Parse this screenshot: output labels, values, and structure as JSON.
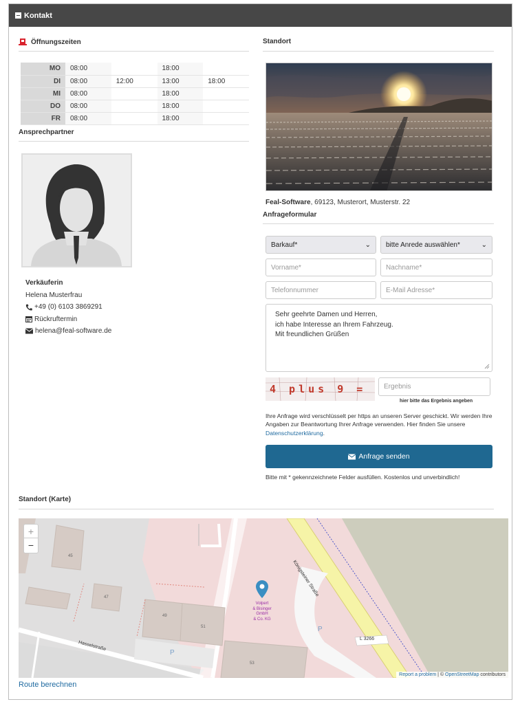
{
  "header": {
    "title": "Kontakt"
  },
  "hours": {
    "title": "Öffnungszeiten",
    "rows": [
      {
        "day": "MO",
        "c1": "08:00",
        "c2": "",
        "c3": "18:00",
        "c4": ""
      },
      {
        "day": "DI",
        "c1": "08:00",
        "c2": "12:00",
        "c3": "13:00",
        "c4": "18:00"
      },
      {
        "day": "MI",
        "c1": "08:00",
        "c2": "",
        "c3": "18:00",
        "c4": ""
      },
      {
        "day": "DO",
        "c1": "08:00",
        "c2": "",
        "c3": "18:00",
        "c4": ""
      },
      {
        "day": "FR",
        "c1": "08:00",
        "c2": "",
        "c3": "18:00",
        "c4": ""
      }
    ]
  },
  "contact_person": {
    "title": "Ansprechpartner",
    "role": "Verkäuferin",
    "name": "Helena Musterfrau",
    "phone": "+49 (0) 6103 3869291",
    "callback": "Rückruftermin",
    "email": "helena@feal-software.de"
  },
  "location": {
    "title": "Standort",
    "company": "Feal-Software",
    "address": ", 69123, Musterort, Musterstr. 22"
  },
  "form": {
    "title": "Anfrageformular",
    "type_select": "Barkauf*",
    "salutation_select": "bitte Anrede auswählen*",
    "firstname_placeholder": "Vorname*",
    "lastname_placeholder": "Nachname*",
    "phone_placeholder": "Telefonnummer",
    "email_placeholder": "E-Mail Adresse*",
    "message_line1": "Sehr geehrte Damen und Herren,",
    "message_line2": "ich habe Interesse an Ihrem Fahrzeug.",
    "message_line3": "Mit freundlichen Grüßen",
    "captcha_text": "4 plus 9 =",
    "result_placeholder": "Ergebnis",
    "result_hint": "hier bitte das Ergebnis angeben",
    "privacy_text": "Ihre Anfrage wird verschlüsselt per https an unseren Server geschickt. Wir werden Ihre Angaben zur Beantwortung Ihrer Anfrage verwenden. Hier finden Sie unsere",
    "privacy_link": "Datenschutzerklärung",
    "privacy_end": ".",
    "send_label": "Anfrage senden",
    "note": "Bitte mit * gekennzeichnete Felder ausfüllen. Kostenlos und unverbindlich!"
  },
  "map": {
    "title": "Standort (Karte)",
    "zoom_in": "+",
    "zoom_out": "−",
    "marker_label_1": "Volpert",
    "marker_label_2": "& Bisinger",
    "marker_label_3": "GmbH",
    "marker_label_4": "& Co. KG",
    "street_1": "Königsteiner Straße",
    "street_2": "Hasselstraße",
    "road_ref": "L 3266",
    "parking": "P",
    "num_45": "45",
    "num_47": "47",
    "num_49": "49",
    "num_51": "51",
    "num_53": "53",
    "attribution_link": "Report a problem",
    "attribution_sep": " | © ",
    "attribution_osm": "OpenStreetMap",
    "attribution_end": " contributors",
    "route_link": "Route berechnen"
  },
  "colors": {
    "header_bg": "#474747",
    "accent": "#1f6891",
    "link": "#1f6aa0",
    "clock_icon": "#d9232d"
  }
}
